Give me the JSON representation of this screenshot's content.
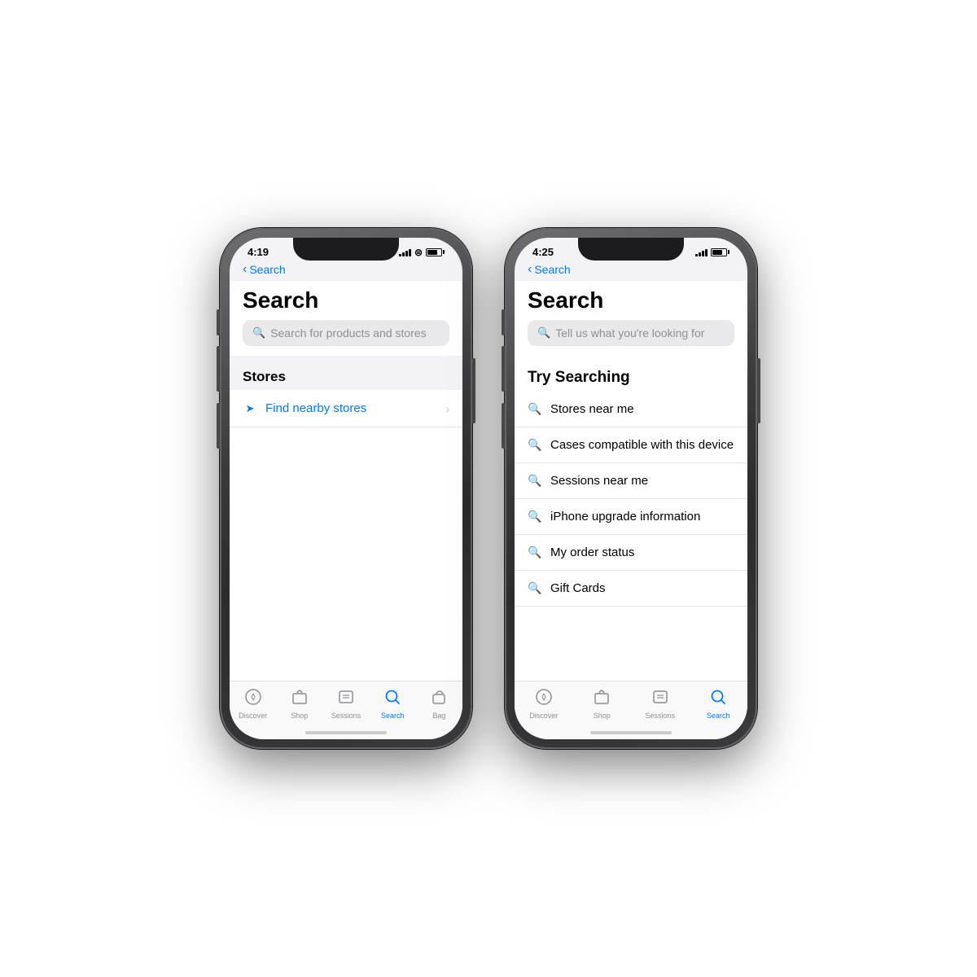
{
  "phone1": {
    "status": {
      "time": "4:19",
      "location": "▲"
    },
    "back_label": "Search",
    "page_title": "Search",
    "search_placeholder": "Search for products and stores",
    "sections": [
      {
        "header": "Stores",
        "items": [
          {
            "text": "Find nearby stores",
            "has_chevron": true
          }
        ]
      }
    ],
    "tabs": [
      {
        "label": "Discover",
        "icon": "◎",
        "active": false
      },
      {
        "label": "Shop",
        "icon": "⊡",
        "active": false
      },
      {
        "label": "Sessions",
        "icon": "⊟",
        "active": false
      },
      {
        "label": "Search",
        "icon": "⌕",
        "active": true
      },
      {
        "label": "Bag",
        "icon": "◻",
        "active": false
      }
    ]
  },
  "phone2": {
    "status": {
      "time": "4:25",
      "location": "▲"
    },
    "back_label": "Search",
    "page_title": "Search",
    "search_placeholder": "Tell us what you're looking for",
    "try_searching_label": "Try Searching",
    "suggestions": [
      {
        "text": "Stores near me"
      },
      {
        "text": "Cases compatible with this device"
      },
      {
        "text": "Sessions near me"
      },
      {
        "text": "iPhone upgrade information"
      },
      {
        "text": "My order status"
      },
      {
        "text": "Gift Cards"
      }
    ],
    "tabs": [
      {
        "label": "Discover",
        "icon": "◎",
        "active": false
      },
      {
        "label": "Shop",
        "icon": "⊡",
        "active": false
      },
      {
        "label": "Sessions",
        "icon": "⊟",
        "active": false
      },
      {
        "label": "Search",
        "icon": "⌕",
        "active": true
      }
    ]
  }
}
